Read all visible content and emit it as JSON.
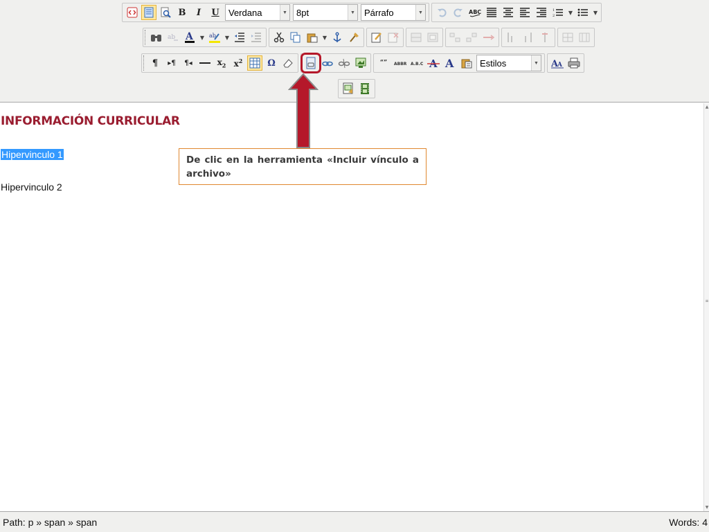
{
  "toolbar": {
    "font_family": "Verdana",
    "font_size": "8pt",
    "format": "Párrafo",
    "styles": "Estilos",
    "bold": "B",
    "italic": "I",
    "underline": "U"
  },
  "content": {
    "heading": "INFORMACIÓN CURRICULAR",
    "links": [
      "Hipervinculo 1",
      "Hipervinculo 2"
    ]
  },
  "callout": {
    "text": "De clic en la herramienta «Incluir vínculo a archivo»"
  },
  "status": {
    "path": "Path: p » span » span",
    "words": "Words: 4"
  },
  "colors": {
    "heading": "#9a1d30",
    "highlight": "#b5182a",
    "selection": "#3399ff",
    "callout_border": "#e0872f"
  }
}
